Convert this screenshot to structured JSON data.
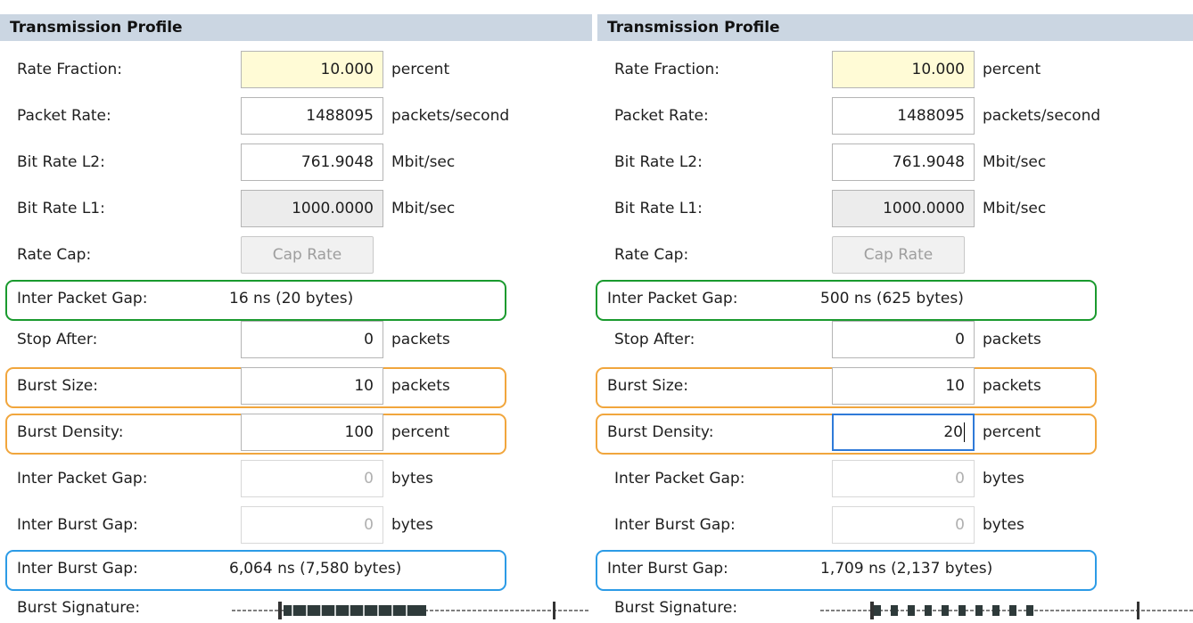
{
  "panels": [
    {
      "header": "Transmission Profile",
      "rate_fraction": {
        "label": "Rate Fraction:",
        "value": "10.000",
        "unit": "percent"
      },
      "packet_rate": {
        "label": "Packet Rate:",
        "value": "1488095",
        "unit": "packets/second"
      },
      "bit_rate_l2": {
        "label": "Bit Rate L2:",
        "value": "761.9048",
        "unit": "Mbit/sec"
      },
      "bit_rate_l1": {
        "label": "Bit Rate L1:",
        "value": "1000.0000",
        "unit": "Mbit/sec"
      },
      "rate_cap": {
        "label": "Rate Cap:",
        "button": "Cap Rate"
      },
      "ipg_info": {
        "label": "Inter Packet Gap:",
        "value": "16 ns (20 bytes)"
      },
      "stop_after": {
        "label": "Stop After:",
        "value": "0",
        "unit": "packets"
      },
      "burst_size": {
        "label": "Burst Size:",
        "value": "10",
        "unit": "packets"
      },
      "burst_density": {
        "label": "Burst Density:",
        "value": "100",
        "unit": "percent"
      },
      "ipg_bytes": {
        "label": "Inter Packet Gap:",
        "value": "0",
        "unit": "bytes"
      },
      "ibg_bytes": {
        "label": "Inter Burst Gap:",
        "value": "0",
        "unit": "bytes"
      },
      "ibg_info": {
        "label": "Inter Burst Gap:",
        "value": "6,064 ns (7,580 bytes)"
      },
      "burst_signature": {
        "label": "Burst Signature:"
      }
    },
    {
      "header": "Transmission Profile",
      "rate_fraction": {
        "label": "Rate Fraction:",
        "value": "10.000",
        "unit": "percent"
      },
      "packet_rate": {
        "label": "Packet Rate:",
        "value": "1488095",
        "unit": "packets/second"
      },
      "bit_rate_l2": {
        "label": "Bit Rate L2:",
        "value": "761.9048",
        "unit": "Mbit/sec"
      },
      "bit_rate_l1": {
        "label": "Bit Rate L1:",
        "value": "1000.0000",
        "unit": "Mbit/sec"
      },
      "rate_cap": {
        "label": "Rate Cap:",
        "button": "Cap Rate"
      },
      "ipg_info": {
        "label": "Inter Packet Gap:",
        "value": "500 ns (625 bytes)"
      },
      "stop_after": {
        "label": "Stop After:",
        "value": "0",
        "unit": "packets"
      },
      "burst_size": {
        "label": "Burst Size:",
        "value": "10",
        "unit": "packets"
      },
      "burst_density": {
        "label": "Burst Density:",
        "value": "20",
        "unit": "percent"
      },
      "ipg_bytes": {
        "label": "Inter Packet Gap:",
        "value": "0",
        "unit": "bytes"
      },
      "ibg_bytes": {
        "label": "Inter Burst Gap:",
        "value": "0",
        "unit": "bytes"
      },
      "ibg_info": {
        "label": "Inter Burst Gap:",
        "value": "1,709 ns (2,137 bytes)"
      },
      "burst_signature": {
        "label": "Burst Signature:"
      }
    }
  ],
  "colors": {
    "header_bg": "#cbd6e2",
    "highlight_green": "#1a9a2e",
    "highlight_orange": "#f1a63d",
    "highlight_blue": "#2c9be6",
    "focus_blue": "#2f7ad8",
    "rate_fraction_bg": "#fffbd6"
  }
}
